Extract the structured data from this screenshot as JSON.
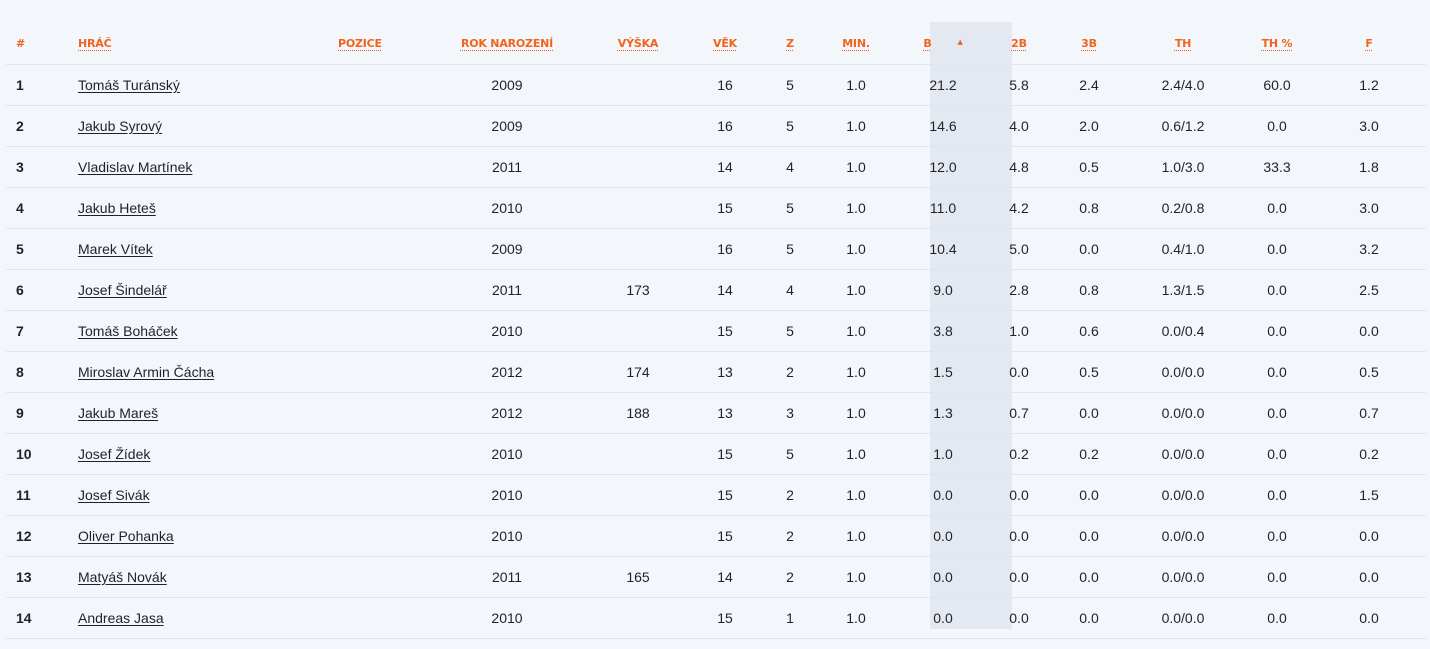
{
  "columns": {
    "idx": "#",
    "player": "Hráč",
    "position": "Pozice",
    "birth_year": "Rok narození",
    "height": "Výška",
    "age": "Věk",
    "games": "Z",
    "minutes": "Min.",
    "points": "B",
    "two_pt": "2B",
    "three_pt": "3B",
    "free_throws": "TH",
    "ft_pct": "TH %",
    "fouls": "F"
  },
  "sort": {
    "column": "points",
    "direction": "desc",
    "arrow_icon": "sort-asc-arrow-icon",
    "accent": "#f0641e",
    "band_color": "#e4e8f1"
  },
  "rows": [
    {
      "idx": "1",
      "player": "Tomáš Turánský",
      "position": "",
      "birth_year": "2009",
      "height": "",
      "age": "16",
      "games": "5",
      "minutes": "1.0",
      "points": "21.2",
      "two_pt": "5.8",
      "three_pt": "2.4",
      "free_throws": "2.4/4.0",
      "ft_pct": "60.0",
      "fouls": "1.2"
    },
    {
      "idx": "2",
      "player": "Jakub Syrový",
      "position": "",
      "birth_year": "2009",
      "height": "",
      "age": "16",
      "games": "5",
      "minutes": "1.0",
      "points": "14.6",
      "two_pt": "4.0",
      "three_pt": "2.0",
      "free_throws": "0.6/1.2",
      "ft_pct": "0.0",
      "fouls": "3.0"
    },
    {
      "idx": "3",
      "player": "Vladislav Martínek",
      "position": "",
      "birth_year": "2011",
      "height": "",
      "age": "14",
      "games": "4",
      "minutes": "1.0",
      "points": "12.0",
      "two_pt": "4.8",
      "three_pt": "0.5",
      "free_throws": "1.0/3.0",
      "ft_pct": "33.3",
      "fouls": "1.8"
    },
    {
      "idx": "4",
      "player": "Jakub Heteš",
      "position": "",
      "birth_year": "2010",
      "height": "",
      "age": "15",
      "games": "5",
      "minutes": "1.0",
      "points": "11.0",
      "two_pt": "4.2",
      "three_pt": "0.8",
      "free_throws": "0.2/0.8",
      "ft_pct": "0.0",
      "fouls": "3.0"
    },
    {
      "idx": "5",
      "player": "Marek Vítek",
      "position": "",
      "birth_year": "2009",
      "height": "",
      "age": "16",
      "games": "5",
      "minutes": "1.0",
      "points": "10.4",
      "two_pt": "5.0",
      "three_pt": "0.0",
      "free_throws": "0.4/1.0",
      "ft_pct": "0.0",
      "fouls": "3.2"
    },
    {
      "idx": "6",
      "player": "Josef Šindelář",
      "position": "",
      "birth_year": "2011",
      "height": "173",
      "age": "14",
      "games": "4",
      "minutes": "1.0",
      "points": "9.0",
      "two_pt": "2.8",
      "three_pt": "0.8",
      "free_throws": "1.3/1.5",
      "ft_pct": "0.0",
      "fouls": "2.5"
    },
    {
      "idx": "7",
      "player": "Tomáš Boháček",
      "position": "",
      "birth_year": "2010",
      "height": "",
      "age": "15",
      "games": "5",
      "minutes": "1.0",
      "points": "3.8",
      "two_pt": "1.0",
      "three_pt": "0.6",
      "free_throws": "0.0/0.4",
      "ft_pct": "0.0",
      "fouls": "0.0"
    },
    {
      "idx": "8",
      "player": "Miroslav Armin Čácha",
      "position": "",
      "birth_year": "2012",
      "height": "174",
      "age": "13",
      "games": "2",
      "minutes": "1.0",
      "points": "1.5",
      "two_pt": "0.0",
      "three_pt": "0.5",
      "free_throws": "0.0/0.0",
      "ft_pct": "0.0",
      "fouls": "0.5"
    },
    {
      "idx": "9",
      "player": "Jakub Mareš",
      "position": "",
      "birth_year": "2012",
      "height": "188",
      "age": "13",
      "games": "3",
      "minutes": "1.0",
      "points": "1.3",
      "two_pt": "0.7",
      "three_pt": "0.0",
      "free_throws": "0.0/0.0",
      "ft_pct": "0.0",
      "fouls": "0.7"
    },
    {
      "idx": "10",
      "player": "Josef Žídek",
      "position": "",
      "birth_year": "2010",
      "height": "",
      "age": "15",
      "games": "5",
      "minutes": "1.0",
      "points": "1.0",
      "two_pt": "0.2",
      "three_pt": "0.2",
      "free_throws": "0.0/0.0",
      "ft_pct": "0.0",
      "fouls": "0.2"
    },
    {
      "idx": "11",
      "player": "Josef Sivák",
      "position": "",
      "birth_year": "2010",
      "height": "",
      "age": "15",
      "games": "2",
      "minutes": "1.0",
      "points": "0.0",
      "two_pt": "0.0",
      "three_pt": "0.0",
      "free_throws": "0.0/0.0",
      "ft_pct": "0.0",
      "fouls": "1.5"
    },
    {
      "idx": "12",
      "player": "Oliver Pohanka",
      "position": "",
      "birth_year": "2010",
      "height": "",
      "age": "15",
      "games": "2",
      "minutes": "1.0",
      "points": "0.0",
      "two_pt": "0.0",
      "three_pt": "0.0",
      "free_throws": "0.0/0.0",
      "ft_pct": "0.0",
      "fouls": "0.0"
    },
    {
      "idx": "13",
      "player": "Matyáš Novák",
      "position": "",
      "birth_year": "2011",
      "height": "165",
      "age": "14",
      "games": "2",
      "minutes": "1.0",
      "points": "0.0",
      "two_pt": "0.0",
      "three_pt": "0.0",
      "free_throws": "0.0/0.0",
      "ft_pct": "0.0",
      "fouls": "0.0"
    },
    {
      "idx": "14",
      "player": "Andreas Jasa",
      "position": "",
      "birth_year": "2010",
      "height": "",
      "age": "15",
      "games": "1",
      "minutes": "1.0",
      "points": "0.0",
      "two_pt": "0.0",
      "three_pt": "0.0",
      "free_throws": "0.0/0.0",
      "ft_pct": "0.0",
      "fouls": "0.0"
    }
  ]
}
